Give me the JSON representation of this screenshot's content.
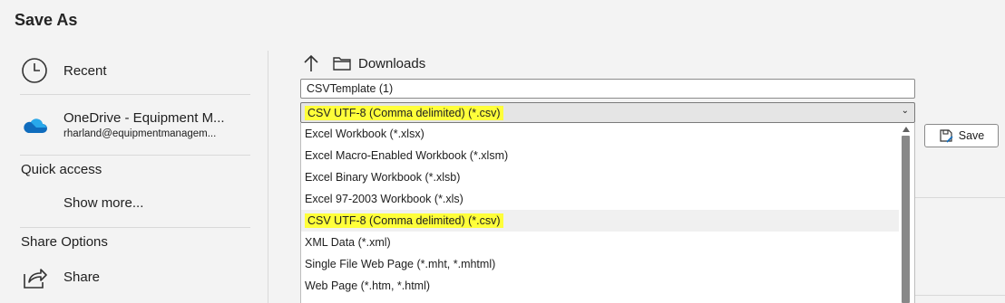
{
  "title": "Save As",
  "nav": {
    "recent": {
      "label": "Recent",
      "icon": "clock-icon"
    },
    "onedrive": {
      "title": "OneDrive - Equipment M...",
      "subtitle": "rharland@equipmentmanagem...",
      "icon": "cloud-icon"
    },
    "quick_access": "Quick access",
    "show_more": "Show more...",
    "share_options": "Share Options",
    "share": {
      "label": "Share",
      "icon": "share-icon"
    }
  },
  "location": {
    "folder": "Downloads",
    "up_icon": "up-arrow-icon",
    "folder_icon": "folder-icon"
  },
  "filename": "CSVTemplate (1)",
  "filetype": {
    "selected": "CSV UTF-8 (Comma delimited) (*.csv)",
    "options": [
      "Excel Workbook (*.xlsx)",
      "Excel Macro-Enabled Workbook (*.xlsm)",
      "Excel Binary Workbook (*.xlsb)",
      "Excel 97-2003 Workbook (*.xls)",
      "CSV UTF-8 (Comma delimited) (*.csv)",
      "XML Data (*.xml)",
      "Single File Web Page (*.mht, *.mhtml)",
      "Web Page (*.htm, *.html)"
    ],
    "selected_index": 4
  },
  "save_button": {
    "label": "Save",
    "icon": "save-icon"
  },
  "colors": {
    "highlight": "#ffff3a",
    "onedrive_blue": "#0f6cbd",
    "background": "#f3f3f3"
  }
}
